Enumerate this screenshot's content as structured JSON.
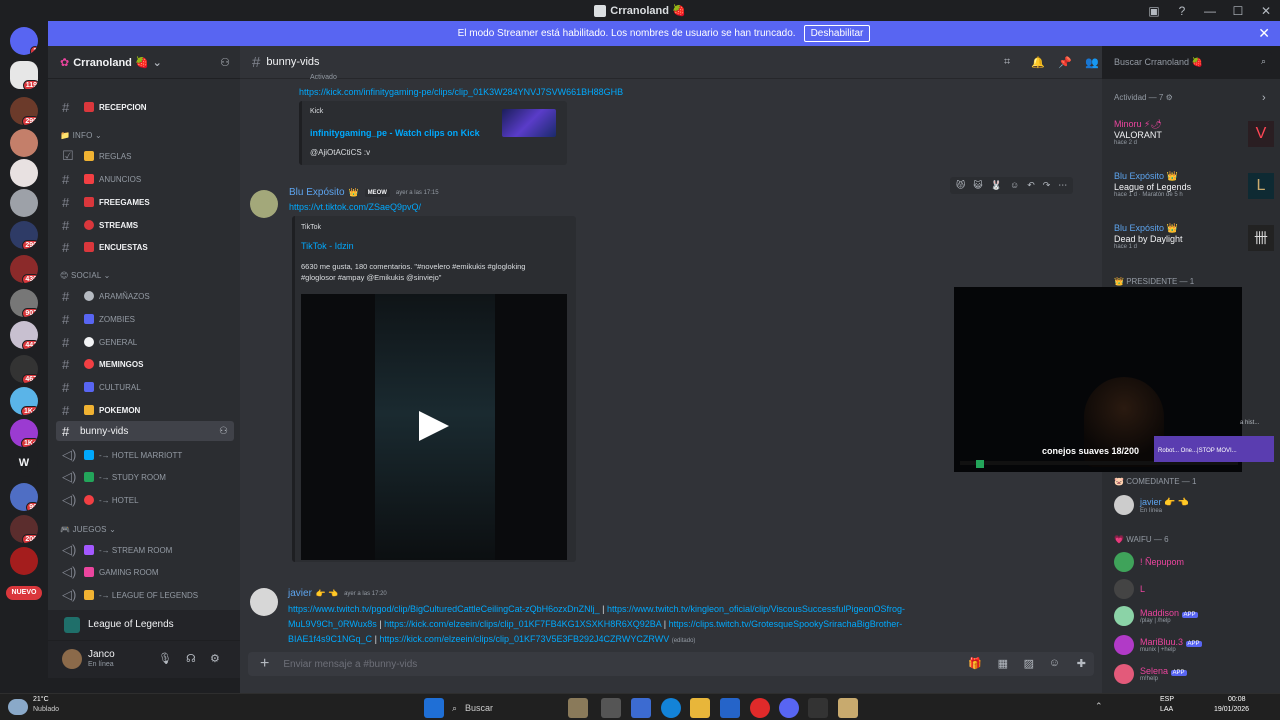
{
  "window": {
    "title": "Crranoland 🍓"
  },
  "banner": {
    "text": "El modo Streamer está habilitado. Los nombres de usuario se han truncado.",
    "button": "Deshabilitar",
    "close": "✕"
  },
  "server": {
    "name": "Crranoland 🍓"
  },
  "server_list": {
    "badges": [
      "1",
      "119",
      "290",
      "430",
      "296",
      "902",
      "441",
      "467",
      "1K+",
      "1K+",
      "90",
      "206"
    ],
    "w_label": "W",
    "nuevo_label": "NUEVO"
  },
  "channels": {
    "top": [
      {
        "name": "RECEPCION",
        "color": "#da373c"
      }
    ],
    "info_cat": "INFO",
    "info": [
      {
        "name": "REGLAS",
        "bold": false,
        "color": "#f0b232"
      },
      {
        "name": "ANUNCIOS",
        "bold": false,
        "color": "#f23f43"
      },
      {
        "name": "FREEGAMES",
        "bold": true,
        "color": "#da373c"
      },
      {
        "name": "STREAMS",
        "bold": true,
        "color": "#da373c"
      },
      {
        "name": "ENCUESTAS",
        "bold": true,
        "color": "#da373c"
      }
    ],
    "social_cat": "SOCIAL",
    "social": [
      {
        "name": "ARAMÑAZOS",
        "bold": false,
        "color": "#b5bac1"
      },
      {
        "name": "ZOMBIES",
        "bold": false,
        "color": "#5865f2"
      },
      {
        "name": "GENERAL",
        "bold": false,
        "color": "#f2f3f5"
      },
      {
        "name": "MEMINGOS",
        "bold": true,
        "color": "#f23f43"
      },
      {
        "name": "CULTURAL",
        "bold": false,
        "color": "#5865f2"
      },
      {
        "name": "POKEMON",
        "bold": true,
        "color": "#f0b232"
      }
    ],
    "active": "bunny-vids",
    "voice_top": [
      {
        "name": "-→ HOTEL MARRIOTT",
        "color": "#00a8fc"
      },
      {
        "name": "-→ STUDY ROOM",
        "color": "#23a55a"
      },
      {
        "name": "-→ HOTEL",
        "color": "#f23f43"
      }
    ],
    "juegos_cat": "JUEGOS",
    "voice_games": [
      {
        "name": "-→ STREAM ROOM",
        "color": "#a358ff"
      },
      {
        "name": "GAMING ROOM",
        "color": "#eb459e"
      },
      {
        "name": "-→ LEAGUE OF LEGENDS",
        "color": "#f0b232"
      }
    ]
  },
  "voice_panel": {
    "label": "League of Legends"
  },
  "user_panel": {
    "name": "Janco",
    "status": "En línea"
  },
  "chat_header": {
    "channel": "bunny-vids"
  },
  "search": {
    "placeholder": "Buscar Crranoland 🍓"
  },
  "messages": {
    "m0": {
      "edited_fragment": "Activado",
      "link": "https://kick.com/infinitygaming-pe/clips/clip_01K3W284YNVJ7SVW661BH88GHB",
      "embed_provider": "Kick",
      "embed_title": "infinitygaming_pe - Watch clips on Kick",
      "embed_desc": "@AjiOtACtiCS :v"
    },
    "m1": {
      "author": "Blu Expósito",
      "crown": "👑",
      "tag": "MEOW",
      "time": "ayer a las 17:15",
      "link": "https://vt.tiktok.com/ZSaeQ9pvQ/",
      "embed_provider": "TikTok",
      "embed_title": "TikTok - Idzin",
      "embed_desc": "6630 me gusta, 180 comentarios. \"#novelero #emikukis #glogloking #gloglosor #ampay @Emikukis @sinviejo\""
    },
    "m2": {
      "author": "javier",
      "emoji": "👉 👈",
      "time": "ayer a las 17:20",
      "line1a": "https://www.twitch.tv/pgod/clip/BigCulturedCattleCeilingCat-zQbH6ozxDnZNlj_",
      "sep1": "|",
      "line1b": "https://www.twitch.tv/kingleon_oficial/clip/ViscousSuccessfulPigeonOSfrog-",
      "line2a": "MuL9V9Ch_0RWux8s",
      "sep2": "|",
      "line2b": "https://kick.com/elzeein/clips/clip_01KF7FB4KG1XSXKH8R6XQ92BA",
      "sep3": "|",
      "line2c": "https://clips.twitch.tv/GrotesqueSpookySrirachaBigBrother-",
      "line3a": "BIAE1f4s9C1NGq_C",
      "sep4": "|",
      "line3b": "https://kick.com/elzeein/clips/clip_01KF73V5E3FB292J4CZRWYCZRWV",
      "edited": "(editado)"
    }
  },
  "composer": {
    "placeholder": "Enviar mensaje a #bunny-vids"
  },
  "members": {
    "activity_header": "Actividad — 7",
    "activities": [
      {
        "user": "Minoru ⚡🌶",
        "game": "VALORANT",
        "time": "hace 2 d"
      },
      {
        "user": "Blu Expósito 👑",
        "game": "League of Legends",
        "time": "hace 1 d",
        "extra": "Maratón de 5 h"
      },
      {
        "user": "Blu Expósito 👑",
        "game": "Dead by Daylight",
        "time": "hace 1 d"
      }
    ],
    "presidente": "PRESIDENTE — 1",
    "comediante": "COMEDIANTE — 1",
    "comediante_members": [
      {
        "name": "javier 👉 👈",
        "status": "En línea"
      }
    ],
    "waifu": "WAIFU — 6",
    "waifu_members": [
      {
        "name": "! Ñepupom",
        "status": ""
      },
      {
        "name": "L",
        "status": ""
      },
      {
        "name": "Maddison",
        "app": "APP",
        "status": "/play | /help"
      },
      {
        "name": "MariBluu.3",
        "app": "APP",
        "status": "munix | +help"
      },
      {
        "name": "Selena",
        "app": "APP",
        "status": "m!help"
      }
    ]
  },
  "stream_overlay": {
    "caption": "conejos suaves 18/200",
    "side1": "a hist...",
    "side2": "Robot... One...|STOP MOVI..."
  },
  "taskbar": {
    "weather_temp": "21°C",
    "weather_desc": "Nublado",
    "search": "Buscar",
    "lang1": "ESP",
    "lang2": "LAA",
    "time": "00:08",
    "date": "19/01/2026"
  }
}
